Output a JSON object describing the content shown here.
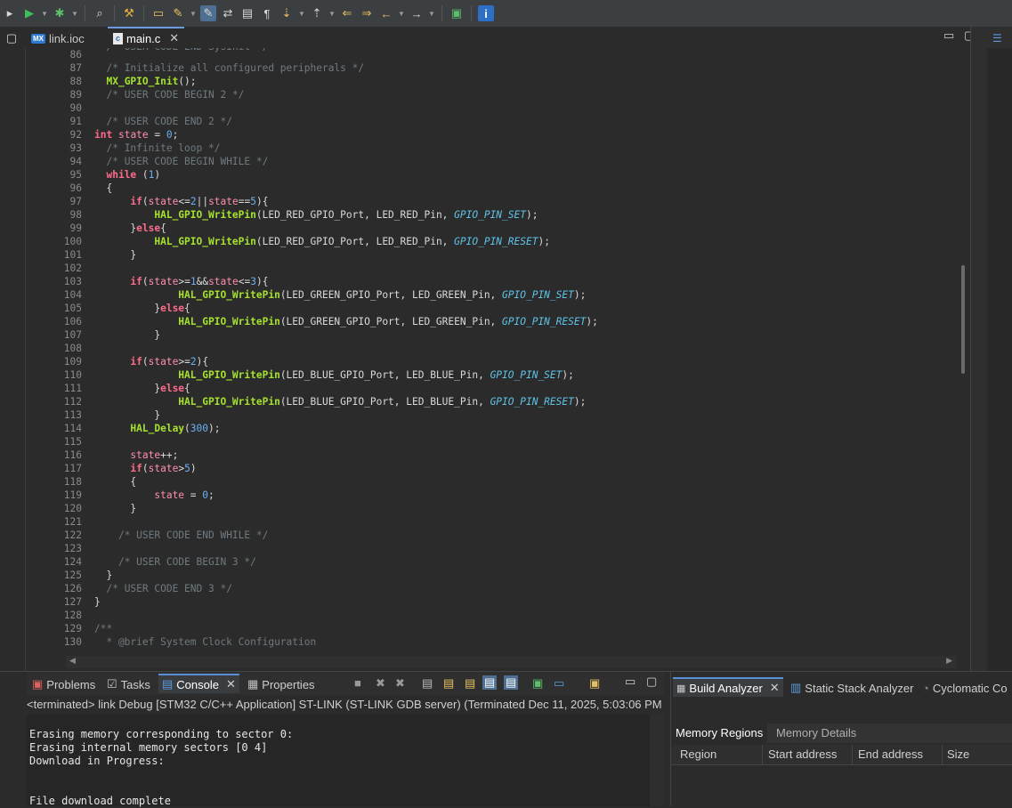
{
  "editor_tabs": [
    {
      "label": "link.ioc",
      "icon": "mx-file-icon"
    },
    {
      "label": "main.c",
      "icon": "c-file-icon"
    }
  ],
  "code": {
    "top_partial": "/* USER CODE END SysInit */",
    "lines": [
      {
        "n": "87",
        "html": "  <span class='cm'>/* Initialize all configured peripherals */</span>"
      },
      {
        "n": "88",
        "html": "  <span class='fn'>MX_GPIO_Init</span>();"
      },
      {
        "n": "89",
        "html": "  <span class='cm'>/* USER CODE BEGIN 2 */</span>"
      },
      {
        "n": "90",
        "html": ""
      },
      {
        "n": "91",
        "html": "  <span class='cm'>/* USER CODE END 2 */</span>"
      },
      {
        "n": "92",
        "html": "<span class='kw'>int</span> <span class='var'>state</span> = <span class='num'>0</span>;"
      },
      {
        "n": "93",
        "html": "  <span class='cm'>/* Infinite loop */</span>"
      },
      {
        "n": "94",
        "html": "  <span class='cm'>/* USER CODE BEGIN WHILE */</span>"
      },
      {
        "n": "95",
        "html": "  <span class='kw'>while</span> (<span class='num'>1</span>)"
      },
      {
        "n": "96",
        "html": "  {"
      },
      {
        "n": "97",
        "html": "      <span class='kw'>if</span>(<span class='var'>state</span>&lt;=<span class='num'>2</span>||<span class='var'>state</span>==<span class='num'>5</span>){"
      },
      {
        "n": "98",
        "html": "          <span class='fn'>HAL_GPIO_WritePin</span>(LED_RED_GPIO_Port, LED_RED_Pin, <span class='it'>GPIO_PIN_SET</span>);"
      },
      {
        "n": "99",
        "html": "      }<span class='kw'>else</span>{"
      },
      {
        "n": "100",
        "html": "          <span class='fn'>HAL_GPIO_WritePin</span>(LED_RED_GPIO_Port, LED_RED_Pin, <span class='it'>GPIO_PIN_RESET</span>);"
      },
      {
        "n": "101",
        "html": "      }"
      },
      {
        "n": "102",
        "html": ""
      },
      {
        "n": "103",
        "html": "      <span class='kw'>if</span>(<span class='var'>state</span>&gt;=<span class='num'>1</span>&amp;&amp;<span class='var'>state</span>&lt;=<span class='num'>3</span>){"
      },
      {
        "n": "104",
        "html": "              <span class='fn'>HAL_GPIO_WritePin</span>(LED_GREEN_GPIO_Port, LED_GREEN_Pin, <span class='it'>GPIO_PIN_SET</span>);"
      },
      {
        "n": "105",
        "html": "          }<span class='kw'>else</span>{"
      },
      {
        "n": "106",
        "html": "              <span class='fn'>HAL_GPIO_WritePin</span>(LED_GREEN_GPIO_Port, LED_GREEN_Pin, <span class='it'>GPIO_PIN_RESET</span>);"
      },
      {
        "n": "107",
        "html": "          }"
      },
      {
        "n": "108",
        "html": ""
      },
      {
        "n": "109",
        "html": "      <span class='kw'>if</span>(<span class='var'>state</span>&gt;=<span class='num'>2</span>){"
      },
      {
        "n": "110",
        "html": "              <span class='fn'>HAL_GPIO_WritePin</span>(LED_BLUE_GPIO_Port, LED_BLUE_Pin, <span class='it'>GPIO_PIN_SET</span>);"
      },
      {
        "n": "111",
        "html": "          }<span class='kw'>else</span>{"
      },
      {
        "n": "112",
        "html": "              <span class='fn'>HAL_GPIO_WritePin</span>(LED_BLUE_GPIO_Port, LED_BLUE_Pin, <span class='it'>GPIO_PIN_RESET</span>);"
      },
      {
        "n": "113",
        "html": "          }"
      },
      {
        "n": "114",
        "html": "      <span class='fn'>HAL_Delay</span>(<span class='num'>300</span>);"
      },
      {
        "n": "115",
        "html": ""
      },
      {
        "n": "116",
        "html": "      <span class='var'>state</span>++;"
      },
      {
        "n": "117",
        "html": "      <span class='kw'>if</span>(<span class='var'>state</span>&gt;<span class='num'>5</span>)"
      },
      {
        "n": "118",
        "html": "      {"
      },
      {
        "n": "119",
        "html": "          <span class='var'>state</span> = <span class='num'>0</span>;"
      },
      {
        "n": "120",
        "html": "      }"
      },
      {
        "n": "121",
        "html": ""
      },
      {
        "n": "122",
        "html": "    <span class='cm'>/* USER CODE END WHILE */</span>"
      },
      {
        "n": "123",
        "html": ""
      },
      {
        "n": "124",
        "html": "    <span class='cm'>/* USER CODE BEGIN 3 */</span>"
      },
      {
        "n": "125",
        "html": "  }"
      },
      {
        "n": "126",
        "html": "  <span class='cm'>/* USER CODE END 3 */</span>"
      },
      {
        "n": "127",
        "html": "}"
      },
      {
        "n": "128",
        "html": ""
      },
      {
        "n": "129",
        "html": "<span class='cm'>/**</span>"
      },
      {
        "n": "130",
        "html": "<span class='cm'>  * @brief System Clock Configuration</span>"
      }
    ],
    "first_line_number": "86"
  },
  "bottom_tabs": [
    {
      "label": "Problems",
      "icon": "problems-icon"
    },
    {
      "label": "Tasks",
      "icon": "tasks-icon"
    },
    {
      "label": "Console",
      "icon": "console-icon"
    },
    {
      "label": "Properties",
      "icon": "properties-icon"
    }
  ],
  "console": {
    "status": "<terminated> link Debug [STM32 C/C++ Application] ST-LINK (ST-LINK GDB server) (Terminated Dec 11, 2025, 5:03:06 PM",
    "lines": [
      "",
      "Erasing memory corresponding to sector 0:",
      "Erasing internal memory sectors [0 4]",
      "Download in Progress:",
      "",
      "",
      "File download complete"
    ]
  },
  "build_analyzer": {
    "tabs": [
      {
        "label": "Build Analyzer"
      },
      {
        "label": "Static Stack Analyzer"
      },
      {
        "label": "Cyclomatic Co"
      }
    ],
    "subtabs": [
      "Memory Regions",
      "Memory Details"
    ],
    "columns": [
      "Region",
      "Start address",
      "End address",
      "Size"
    ]
  }
}
